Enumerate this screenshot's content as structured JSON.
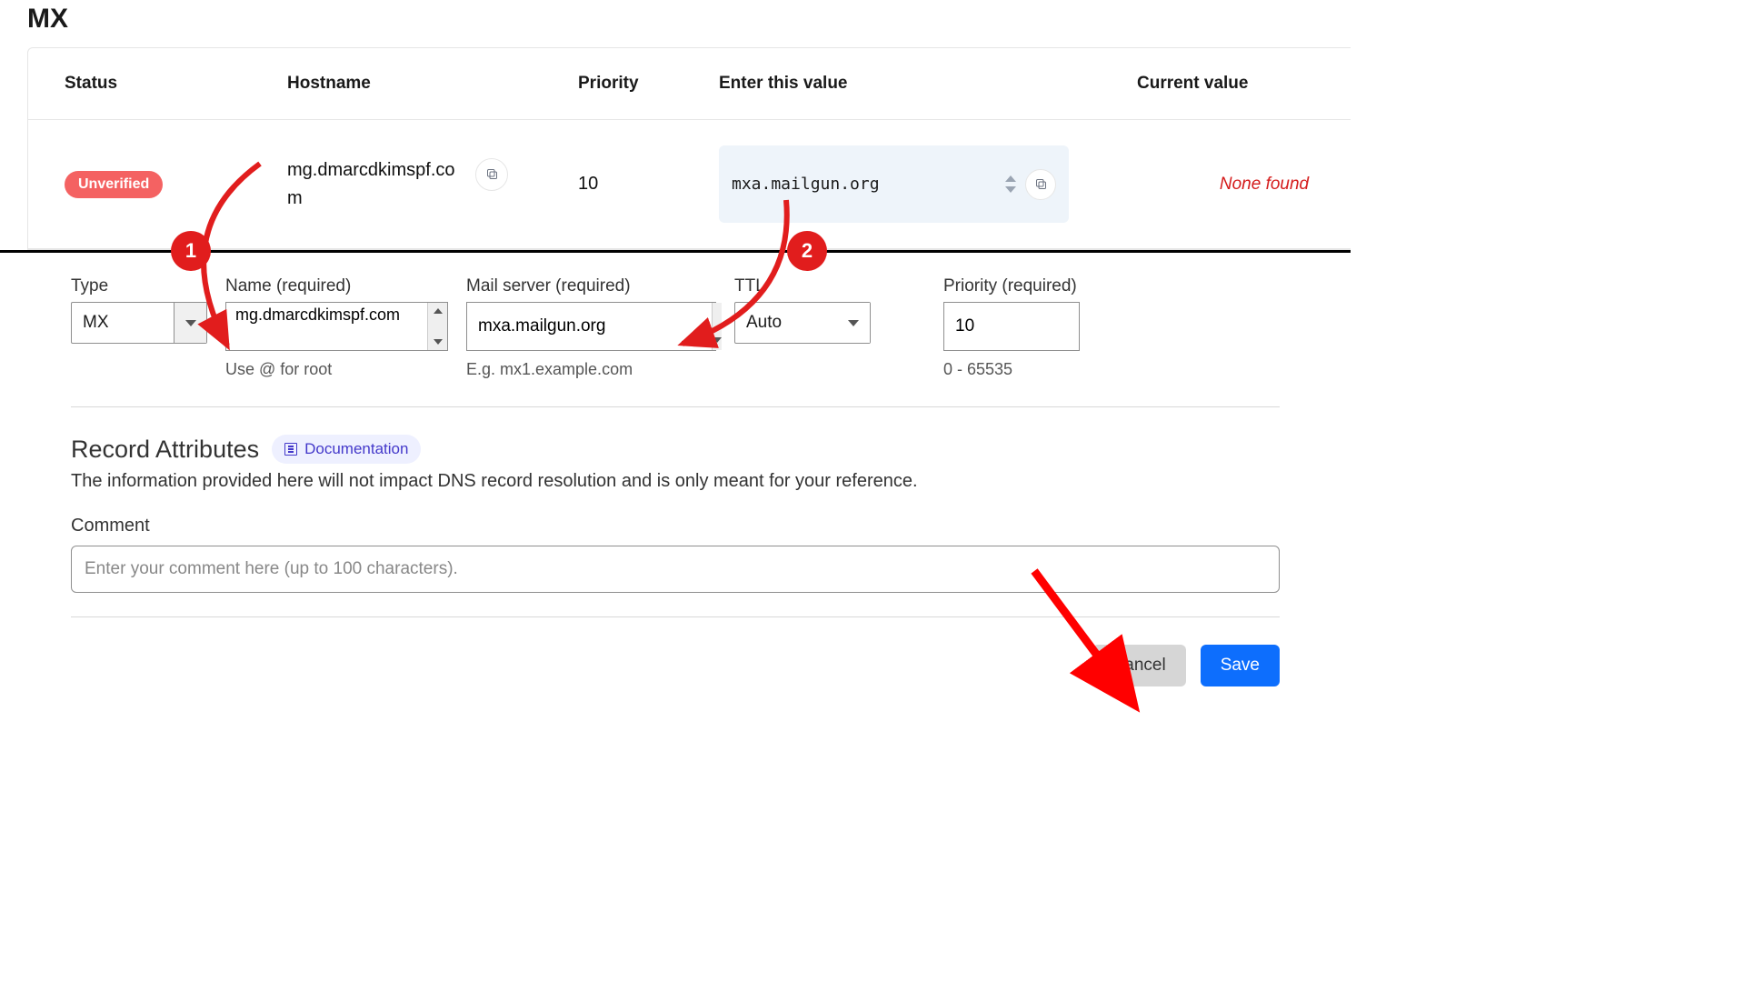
{
  "page_title": "MX",
  "table": {
    "headers": {
      "status": "Status",
      "hostname": "Hostname",
      "priority": "Priority",
      "enter_value": "Enter this value",
      "current_value": "Current value"
    },
    "row": {
      "status_label": "Unverified",
      "hostname": "mg.dmarcdkimspf.com",
      "priority": "10",
      "enter_value": "mxa.mailgun.org",
      "current_value": "None found"
    }
  },
  "form": {
    "type": {
      "label": "Type",
      "value": "MX"
    },
    "name": {
      "label": "Name (required)",
      "value": "mg.dmarcdkimspf.com",
      "helper": "Use @ for root"
    },
    "mail_server": {
      "label": "Mail server (required)",
      "value": "mxa.mailgun.org",
      "helper": "E.g. mx1.example.com"
    },
    "ttl": {
      "label": "TTL",
      "value": "Auto"
    },
    "priority": {
      "label": "Priority (required)",
      "value": "10",
      "helper": "0 - 65535"
    }
  },
  "attributes": {
    "title": "Record Attributes",
    "doc_label": "Documentation",
    "description": "The information provided here will not impact DNS record resolution and is only meant for your reference.",
    "comment_label": "Comment",
    "comment_placeholder": "Enter your comment here (up to 100 characters)."
  },
  "buttons": {
    "cancel": "Cancel",
    "save": "Save"
  },
  "annotations": {
    "one": "1",
    "two": "2"
  }
}
